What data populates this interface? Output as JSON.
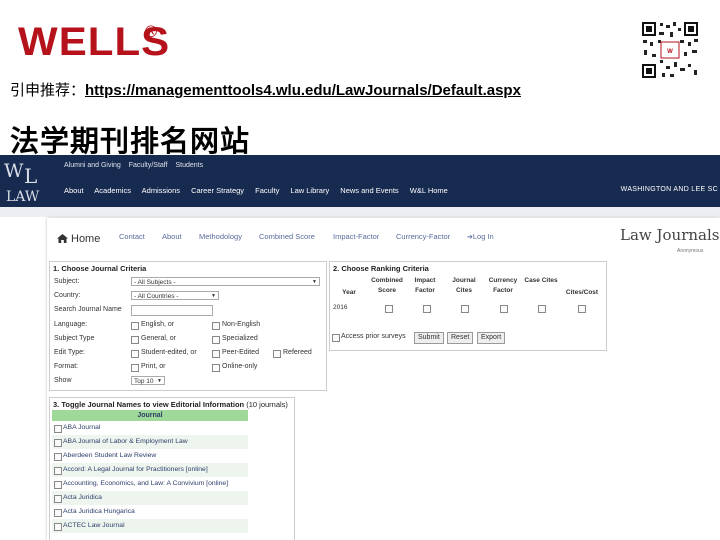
{
  "slide": {
    "logo_text": "WELLS",
    "logo_reg": "®",
    "recommend_label": "引申推荐：",
    "recommend_url": "https://managementtools4.wlu.edu/LawJournals/Default.aspx",
    "title": "法学期刊排名网站"
  },
  "site": {
    "logo_text": "W&L LAW",
    "utility_links": [
      "Alumni and Giving",
      "Faculty/Staff",
      "Students"
    ],
    "main_nav": [
      "About",
      "Academics",
      "Admissions",
      "Career Strategy",
      "Faculty",
      "Law Library",
      "News and Events",
      "W&L Home"
    ],
    "university": "WASHINGTON AND LEE SC",
    "nav": {
      "home": "Home",
      "links": [
        "Contact",
        "About",
        "Methodology",
        "Combined Score",
        "Impact-Factor",
        "Currency-Factor"
      ],
      "login": "Log In"
    },
    "brand": "Law Journals",
    "user": "Anonymous"
  },
  "criteria": {
    "heading": "1. Choose Journal Criteria",
    "subject": {
      "label": "Subject:",
      "value": "- All Subjects -"
    },
    "country": {
      "label": "Country:",
      "value": "- All Countries -"
    },
    "search": {
      "label": "Search Journal Name",
      "value": ""
    },
    "language": {
      "label": "Language:",
      "opt1": "English, or",
      "opt2": "Non-English"
    },
    "subject_type": {
      "label": "Subject Type",
      "opt1": "General, or",
      "opt2": "Specialized"
    },
    "edit_type": {
      "label": "Edit Type:",
      "opt1": "Student-edited, or",
      "opt2": "Peer-Edited",
      "opt3": "Refereed"
    },
    "format": {
      "label": "Format:",
      "opt1": "Print, or",
      "opt2": "Online-only"
    },
    "show": {
      "label": "Show",
      "value": "Top 10"
    }
  },
  "ranking": {
    "heading": "2. Choose Ranking Criteria",
    "columns": [
      "Year",
      "Combined Score",
      "Impact Factor",
      "Journal Cites",
      "Currency Factor",
      "Case Cites",
      "Cites/Cost"
    ],
    "year": "2016",
    "access": "Access prior surveys",
    "buttons": [
      "Submit",
      "Reset",
      "Export"
    ]
  },
  "journals": {
    "heading": "3. Toggle Journal Names to view Editorial Information",
    "count": "(10 journals)",
    "column": "Journal",
    "items": [
      "ABA Journal",
      "ABA Journal of Labor & Employment Law",
      "Aberdeen Student Law Review",
      "Accord: A Legal Journal for Practitioners [online]",
      "Accounting, Economics, and Law: A Convivium [online]",
      "Acta Juridica",
      "Acta Juridica Hungarica",
      "ACTEC Law Journal"
    ]
  },
  "colors": {
    "wells_red": "#b5121b",
    "wl_navy": "#172a4f",
    "green_header": "#9ed99a",
    "row_alt": "#eef5ee"
  }
}
